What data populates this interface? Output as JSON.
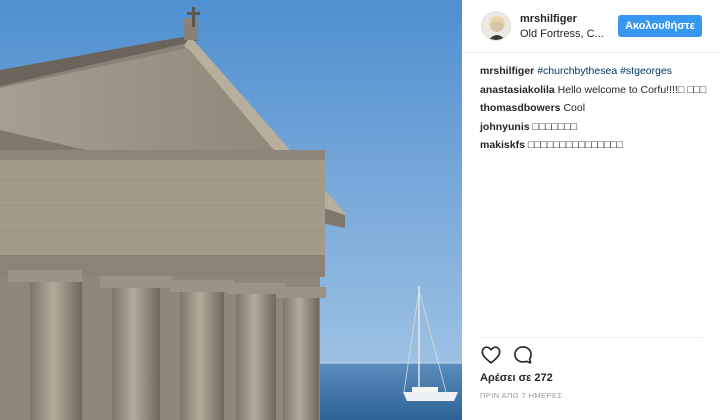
{
  "post": {
    "username": "mrshilfiger",
    "location": "Old Fortress, C...",
    "follow_label": "Ακολουθήστε",
    "caption_author": "mrshilfiger",
    "caption_tags": [
      "#churchbythesea",
      "#stgeorges"
    ],
    "comments": [
      {
        "author": "anastasiakolila",
        "text": "Hello welcome to Corfu!!!!□ □□□"
      },
      {
        "author": "thomasdbowers",
        "text": "Cool"
      },
      {
        "author": "johnyunis",
        "text": "□□□□□□□"
      },
      {
        "author": "makiskfs",
        "text": "□□□□□□□□□□□□□□□"
      }
    ],
    "likes_label": "Αρέσει σε 272",
    "time_label": "ΠΡΙΝ ΑΠΟ 7 ΗΜΕΡΕΣ"
  },
  "icons": {
    "like": "heart-icon",
    "comment": "speech-bubble-icon"
  },
  "colors": {
    "accent": "#3897f0",
    "hashtag": "#003569",
    "sky": "#6fa8dc",
    "sea": "#4a7fb0",
    "stone": "#9a9285"
  }
}
